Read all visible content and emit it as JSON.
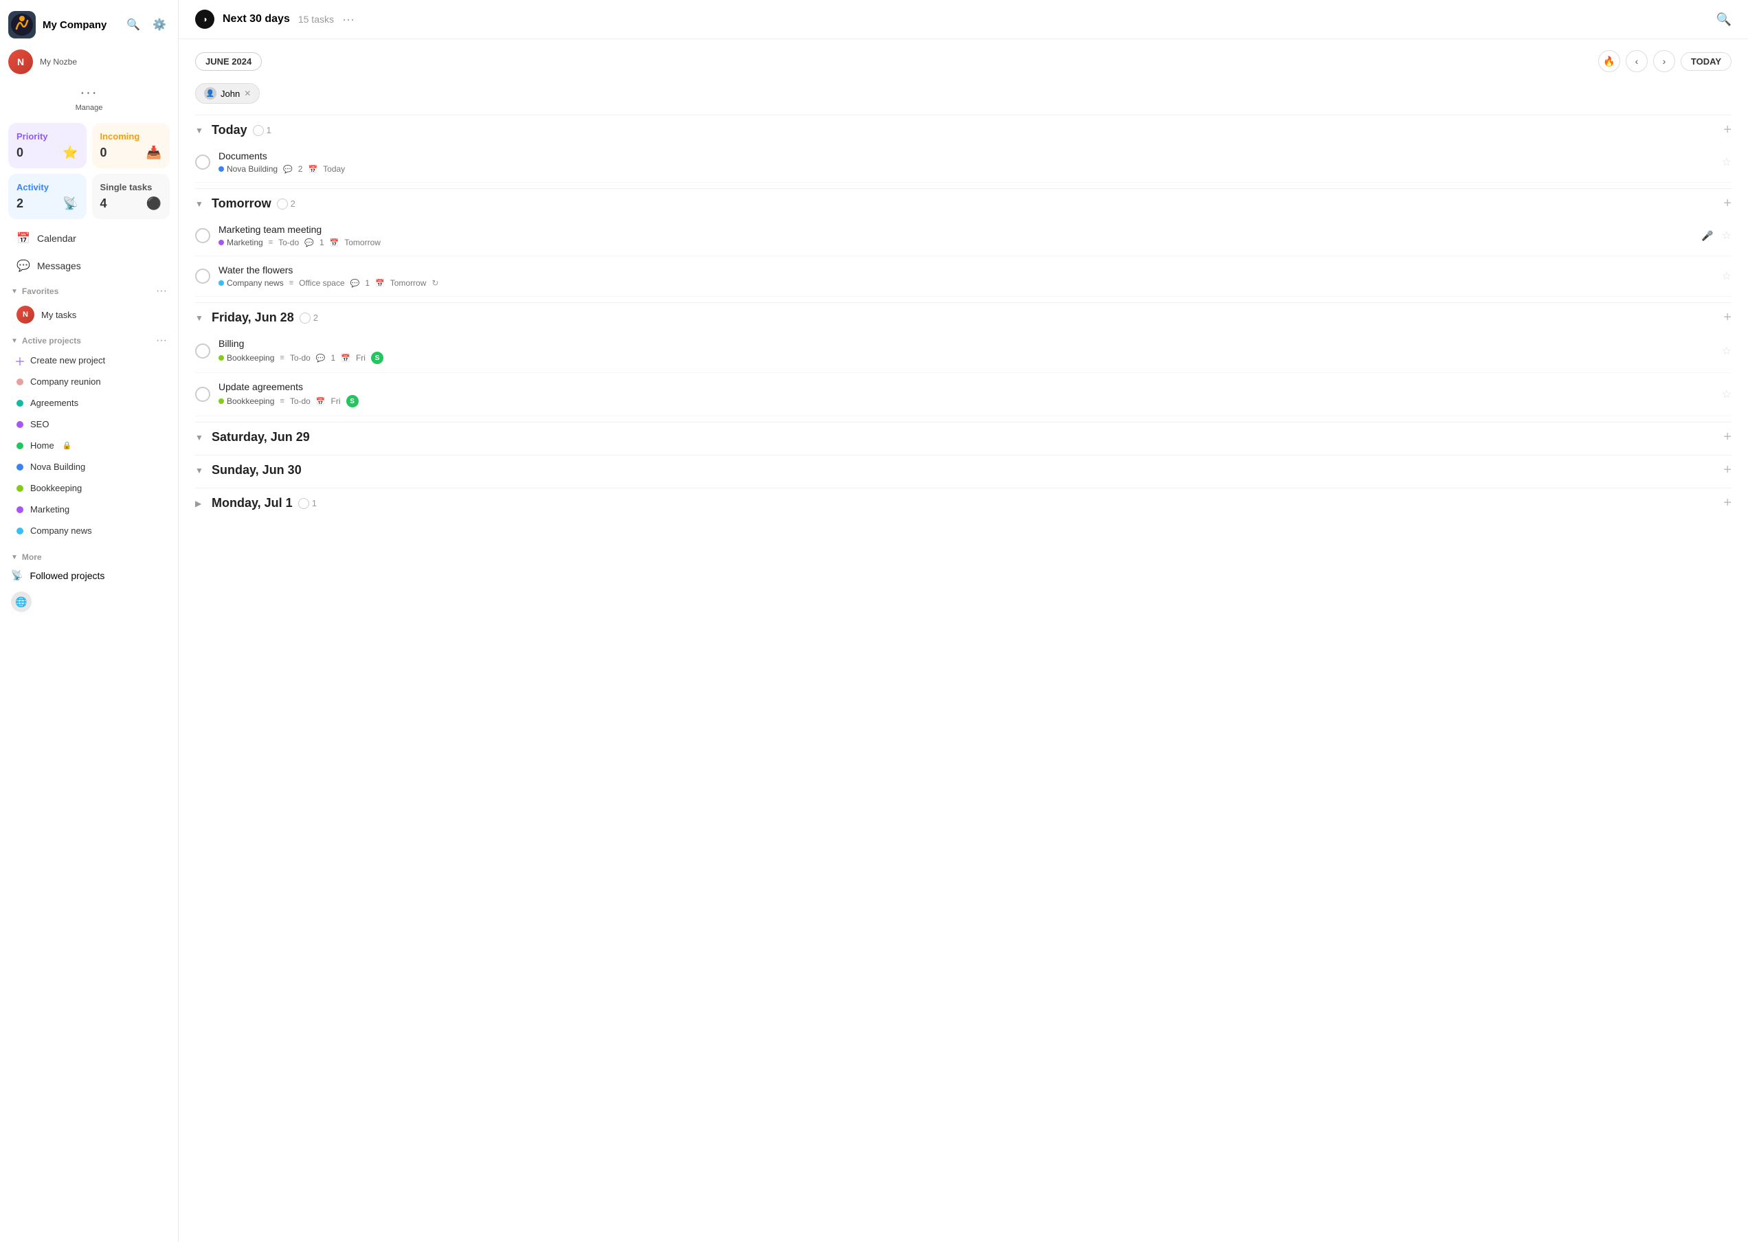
{
  "sidebar": {
    "company_name": "My Company",
    "company_label": "My Company",
    "user_label": "My Nozbe",
    "manage_label": "Manage",
    "stats": [
      {
        "id": "priority",
        "title": "Priority",
        "count": "0",
        "icon": "⭐",
        "type": "priority"
      },
      {
        "id": "incoming",
        "title": "Incoming",
        "count": "0",
        "icon": "📥",
        "type": "incoming"
      },
      {
        "id": "activity",
        "title": "Activity",
        "count": "2",
        "icon": "📡",
        "type": "activity"
      },
      {
        "id": "single",
        "title": "Single tasks",
        "count": "4",
        "icon": "⚫",
        "type": "single"
      }
    ],
    "nav": [
      {
        "id": "calendar",
        "label": "Calendar",
        "icon": "📅"
      },
      {
        "id": "messages",
        "label": "Messages",
        "icon": "💬"
      }
    ],
    "favorites_label": "Favorites",
    "my_tasks_label": "My tasks",
    "active_projects_label": "Active projects",
    "projects": [
      {
        "id": "create-new",
        "name": "Create new project",
        "color": null,
        "plus": true
      },
      {
        "id": "company-reunion",
        "name": "Company reunion",
        "color": "#e8a09a",
        "plus": false
      },
      {
        "id": "agreements",
        "name": "Agreements",
        "color": "#14b8a6",
        "plus": false
      },
      {
        "id": "seo",
        "name": "SEO",
        "color": "#a855f7",
        "plus": false
      },
      {
        "id": "home",
        "name": "Home",
        "color": "#22c55e",
        "plus": false,
        "lock": true
      },
      {
        "id": "nova-building",
        "name": "Nova Building",
        "color": "#3b82f6",
        "plus": false
      },
      {
        "id": "bookkeeping",
        "name": "Bookkeeping",
        "color": "#84cc16",
        "plus": false
      },
      {
        "id": "marketing",
        "name": "Marketing",
        "color": "#a855f7",
        "plus": false
      },
      {
        "id": "company-news",
        "name": "Company news",
        "color": "#38bdf8",
        "plus": false
      }
    ],
    "more_label": "More",
    "followed_label": "Followed projects"
  },
  "header": {
    "icon": "◑",
    "title": "Next 30 days",
    "task_count": "15 tasks",
    "more_icon": "···"
  },
  "filters": {
    "month_badge": "JUNE 2024",
    "today_btn": "TODAY",
    "user_tag": "John",
    "fire_icon": "🔥",
    "prev_icon": "‹",
    "next_icon": "›"
  },
  "task_groups": [
    {
      "id": "today",
      "title": "Today",
      "count": "1",
      "expanded": true,
      "tasks": [
        {
          "id": "documents",
          "name": "Documents",
          "project": "Nova Building",
          "project_color": "#3b82f6",
          "section": null,
          "comments": "2",
          "date": "Today",
          "date_icon": "📅",
          "has_mic": false,
          "has_repeat": false,
          "avatar": null
        }
      ]
    },
    {
      "id": "tomorrow",
      "title": "Tomorrow",
      "count": "2",
      "expanded": true,
      "tasks": [
        {
          "id": "marketing-team-meeting",
          "name": "Marketing team meeting",
          "project": "Marketing",
          "project_color": "#a855f7",
          "section": "To-do",
          "comments": "1",
          "date": "Tomorrow",
          "date_icon": "📅",
          "has_mic": true,
          "has_repeat": false,
          "avatar": null
        },
        {
          "id": "water-flowers",
          "name": "Water the flowers",
          "project": "Company news",
          "project_color": "#38bdf8",
          "section": "Office space",
          "comments": "1",
          "date": "Tomorrow",
          "date_icon": "📅",
          "has_mic": false,
          "has_repeat": true,
          "avatar": null
        }
      ]
    },
    {
      "id": "fri-jun-28",
      "title": "Friday, Jun 28",
      "count": "2",
      "expanded": true,
      "tasks": [
        {
          "id": "billing",
          "name": "Billing",
          "project": "Bookkeeping",
          "project_color": "#84cc16",
          "section": "To-do",
          "comments": "1",
          "date": "Fri",
          "date_icon": "📅",
          "has_mic": false,
          "has_repeat": false,
          "avatar": "S",
          "avatar_color": "#22c55e"
        },
        {
          "id": "update-agreements",
          "name": "Update agreements",
          "project": "Bookkeeping",
          "project_color": "#84cc16",
          "section": "To-do",
          "comments": null,
          "date": "Fri",
          "date_icon": "📅",
          "has_mic": false,
          "has_repeat": false,
          "avatar": "S",
          "avatar_color": "#22c55e"
        }
      ]
    },
    {
      "id": "sat-jun-29",
      "title": "Saturday, Jun 29",
      "count": "0",
      "expanded": true,
      "tasks": []
    },
    {
      "id": "sun-jun-30",
      "title": "Sunday, Jun 30",
      "count": "0",
      "expanded": true,
      "tasks": []
    },
    {
      "id": "mon-jul-1",
      "title": "Monday, Jul 1",
      "count": "1",
      "expanded": false,
      "tasks": []
    }
  ]
}
